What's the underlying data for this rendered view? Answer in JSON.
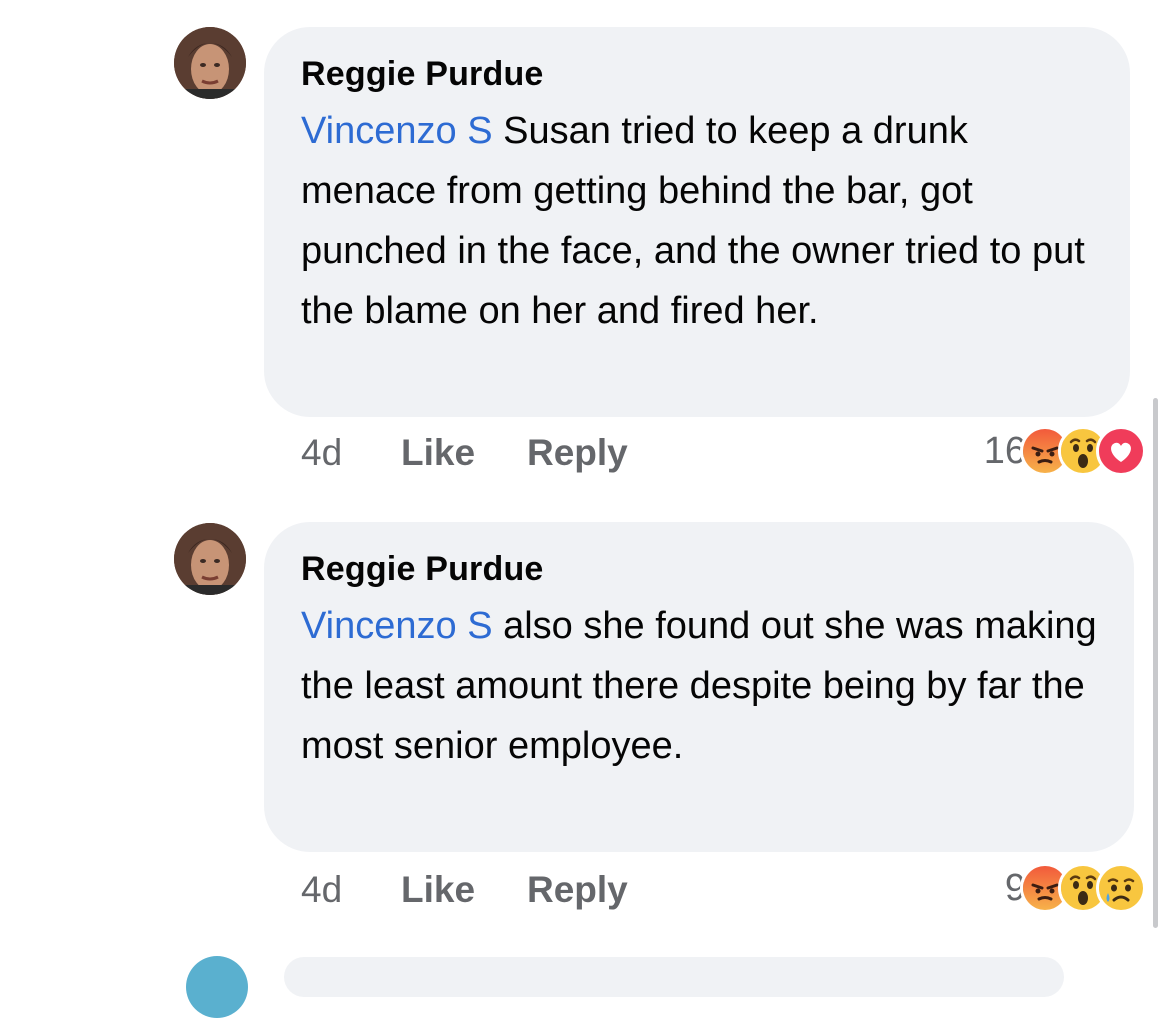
{
  "comments": [
    {
      "author": "Reggie Purdue",
      "mention": "Vincenzo S",
      "text": " Susan tried to keep a drunk menace from getting behind the bar, got punched in the face, and the owner tried to put the blame on her and fired her.",
      "time": "4d",
      "like_label": "Like",
      "reply_label": "Reply",
      "reaction_count": "16",
      "reactions": [
        "angry",
        "wow",
        "love"
      ]
    },
    {
      "author": "Reggie Purdue",
      "mention": "Vincenzo S",
      "text": " also she found out she was making the least amount there despite being by far the most senior employee.",
      "time": "4d",
      "like_label": "Like",
      "reply_label": "Reply",
      "reaction_count": "9",
      "reactions": [
        "angry",
        "wow",
        "sad"
      ]
    }
  ],
  "colors": {
    "bubble": "#f0f2f5",
    "mention": "#2d6bd3",
    "meta": "#65676b",
    "text": "#050505"
  }
}
